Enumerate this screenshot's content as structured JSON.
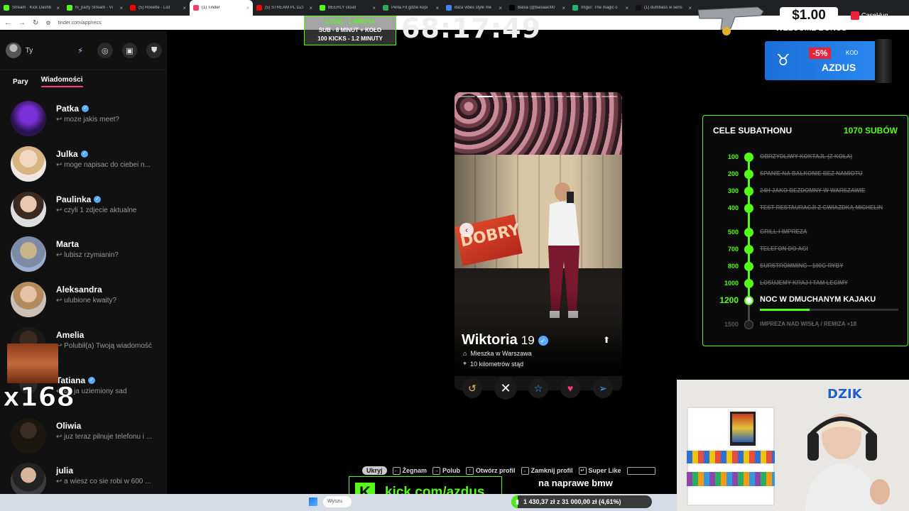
{
  "browser": {
    "tabs": [
      {
        "title": "Stream · Kick Dashb",
        "color": "#53fc18"
      },
      {
        "title": "hi_party Stream - Vi",
        "color": "#53fc18"
      },
      {
        "title": "(5) Roxette - List",
        "color": "#ff0000"
      },
      {
        "title": "(1) Tinder",
        "color": "#fe3c72",
        "active": true
      },
      {
        "title": "(5) STREAM PL DZI",
        "color": "#ff0000"
      },
      {
        "title": "BEERLY cloud",
        "color": "#53fc18"
      },
      {
        "title": "Perła Fit gdzie kupi",
        "color": "#34a853"
      },
      {
        "title": "ibiza vibes style me",
        "color": "#4285f4"
      },
      {
        "title": "Basia (@basiaa000",
        "color": "#000000"
      },
      {
        "title": "Imgur: The magic o",
        "color": "#1bb76e"
      },
      {
        "title": "(1) dumbass w sens",
        "color": "#111111"
      }
    ],
    "url": "tinder.com/app/recs"
  },
  "sidebar": {
    "user_name": "Ty",
    "tabs": {
      "matches": "Pary",
      "messages": "Wiadomości"
    },
    "messages": [
      {
        "name": "Patka",
        "verified": true,
        "preview": "moze jakis meet?"
      },
      {
        "name": "Julka",
        "verified": true,
        "preview": "moge napisac do ciebei n..."
      },
      {
        "name": "Paulinka",
        "verified": true,
        "preview": "czyli 1 zdjecie aktualne"
      },
      {
        "name": "Marta",
        "verified": false,
        "preview": "lubisz rzymianin?"
      },
      {
        "name": "Aleksandra",
        "verified": false,
        "preview": "ulubione kwaity?"
      },
      {
        "name": "Amelia",
        "verified": false,
        "preview": "Polubił(a) Twoją wiadomość"
      },
      {
        "name": "Tatiana",
        "verified": true,
        "preview": "bo ja uziemiony sad"
      },
      {
        "name": "Oliwia",
        "verified": false,
        "preview": "juz teraz pilnuje telefonu i ..."
      },
      {
        "name": "julia",
        "verified": false,
        "preview": "a wiesz co sie robi w 600 ..."
      }
    ]
  },
  "overlay": {
    "sub_banner": {
      "line1": "2.15ZŁ - 1 MINUTA",
      "line2": "SUB - 8 MINUT + KOŁO",
      "line3": "100 KICKS - 1.2 MINUTY"
    },
    "timer": "68:17:49",
    "multiplier": "x168",
    "bonus_amount": "$1.00",
    "bonus_label": "WELCOME BONUS",
    "casehug_label": "CaseHug",
    "dzik_discount": "-5%",
    "dzik_kod": "KOD",
    "dzik_code": "AZDUS",
    "kick_url": "kick.com/azdus",
    "ticker": "na naprawe bmw",
    "donation": {
      "text": "1 430,37 zł z 31 000,00 zł (4,61%)",
      "percent": 4.61
    },
    "cam_logo": "DZIK"
  },
  "card": {
    "name": "Wiktoria",
    "age": "19",
    "verified": true,
    "lives": "Mieszka w Warszawa",
    "distance": "10 kilometrów stąd",
    "photo_count": 9,
    "current_photo": 2,
    "sticker_text": "DOBRY"
  },
  "goals": {
    "title": "CELE SUBATHONU",
    "count": "1070 SUBÓW",
    "items": [
      {
        "amount": "100",
        "label": "OBRZYDLIWY KOKTAJL (Z KOŁA)",
        "state": "done"
      },
      {
        "amount": "200",
        "label": "SPANIE NA BALKONIE BEZ NAMIOTU",
        "state": "done"
      },
      {
        "amount": "300",
        "label": "24H JAKO BEZDOMNY W WARSZAWIE",
        "state": "done"
      },
      {
        "amount": "400",
        "label": "TEST RESTAURACJI Z GWIAZDKĄ MICHELIN",
        "state": "done"
      },
      {
        "amount": "500",
        "label": "GRILL I IMPREZA",
        "state": "done"
      },
      {
        "amount": "700",
        "label": "TELEFON DO AGI",
        "state": "done"
      },
      {
        "amount": "800",
        "label": "SURSTRÖMMING - 100G RYBY",
        "state": "done"
      },
      {
        "amount": "1000",
        "label": "LOSUJEMY KRAJ I TAM LECIMY",
        "state": "done"
      },
      {
        "amount": "1200",
        "label": "NOC W DMUCHANYM KAJAKU",
        "state": "current",
        "progress": 0.36
      },
      {
        "amount": "1500",
        "label": "IMPREZA NAD WISŁĄ / REMIZA +18",
        "state": "future"
      }
    ]
  },
  "shortcuts": {
    "hide": "Ukryj",
    "items": [
      {
        "key": "←",
        "label": "Żegnam"
      },
      {
        "key": "→",
        "label": "Polub"
      },
      {
        "key": "↑",
        "label": "Otwórz profil"
      },
      {
        "key": "↓",
        "label": "Zamknij profil"
      },
      {
        "key": "↵",
        "label": "Super Like"
      }
    ]
  },
  "taskbar": {
    "search_placeholder": "Wyszu"
  }
}
